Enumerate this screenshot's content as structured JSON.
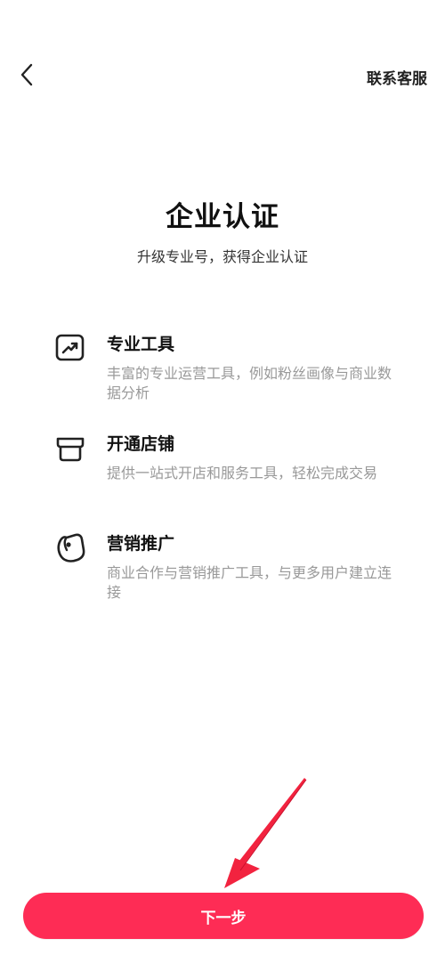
{
  "header": {
    "back_icon": "chevron-left-icon",
    "contact_label": "联系客服"
  },
  "hero": {
    "title": "企业认证",
    "subtitle": "升级专业号，获得企业认证"
  },
  "features": [
    {
      "icon": "trend-chart-icon",
      "title": "专业工具",
      "desc": "丰富的专业运营工具，例如粉丝画像与商业数据分析"
    },
    {
      "icon": "store-icon",
      "title": "开通店铺",
      "desc": "提供一站式开店和服务工具，轻松完成交易"
    },
    {
      "icon": "price-tag-icon",
      "title": "营销推广",
      "desc": "商业合作与营销推广工具，与更多用户建立连接"
    }
  ],
  "footer": {
    "next_label": "下一步"
  },
  "colors": {
    "primary": "#fe2c55",
    "title_text": "#111111",
    "desc_text": "#999999",
    "background": "#ffffff"
  }
}
